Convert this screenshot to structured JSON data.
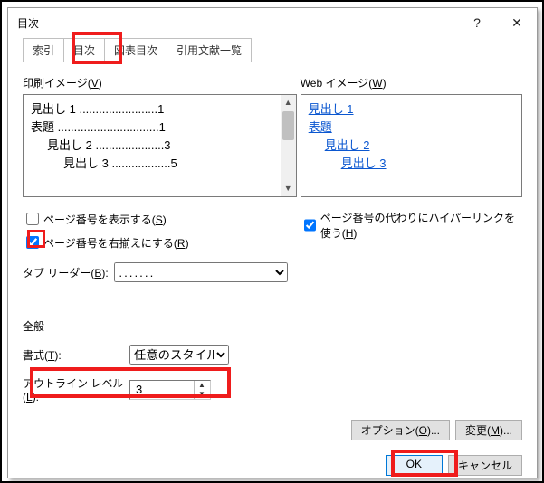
{
  "title": "目次",
  "tabs": {
    "t0": "索引",
    "t1": "目次",
    "t2": "図表目次",
    "t3": "引用文献一覧"
  },
  "print_preview": {
    "label": "印刷イメージ(",
    "key": "V",
    "close": ")",
    "rows": [
      {
        "indent": 0,
        "t": "見出し 1",
        "dots": "........................",
        "p": "1"
      },
      {
        "indent": 0,
        "t": "表題",
        "dots": "...............................",
        "p": "1"
      },
      {
        "indent": 1,
        "t": "見出し 2",
        "dots": ".....................",
        "p": "3"
      },
      {
        "indent": 2,
        "t": "見出し 3",
        "dots": "..................",
        "p": "5"
      }
    ]
  },
  "web_preview": {
    "label": "Web イメージ(",
    "key": "W",
    "close": ")",
    "links": [
      {
        "indent": 0,
        "t": "見出し 1"
      },
      {
        "indent": 0,
        "t": "表題"
      },
      {
        "indent": 1,
        "t": "見出し 2"
      },
      {
        "indent": 2,
        "t": "見出し 3"
      }
    ]
  },
  "show_page_label": "ページ番号を表示する(",
  "show_page_key": "S",
  "show_page_close": ")",
  "right_align_label": "ページ番号を右揃えにする(",
  "right_align_key": "R",
  "right_align_close": ")",
  "hyperlink_label": "ページ番号の代わりにハイパーリンクを使う(",
  "hyperlink_key": "H",
  "hyperlink_close": ")",
  "tab_leader_label": "タブ リーダー(",
  "tab_leader_key": "B",
  "tab_leader_close": "):",
  "tab_leader_value": ".......",
  "general": {
    "header": "全般",
    "style_label": "書式(",
    "style_key": "T",
    "style_close": "):",
    "style_value": "任意のスタイル",
    "outline_label": "アウトライン レベル(",
    "outline_key": "L",
    "outline_close": "):",
    "outline_value": "3"
  },
  "btns": {
    "options": "オプション(",
    "options_key": "O",
    "options_close": ")...",
    "modify": "変更(",
    "modify_key": "M",
    "modify_close": ")...",
    "ok": "OK",
    "cancel": "キャンセル"
  }
}
